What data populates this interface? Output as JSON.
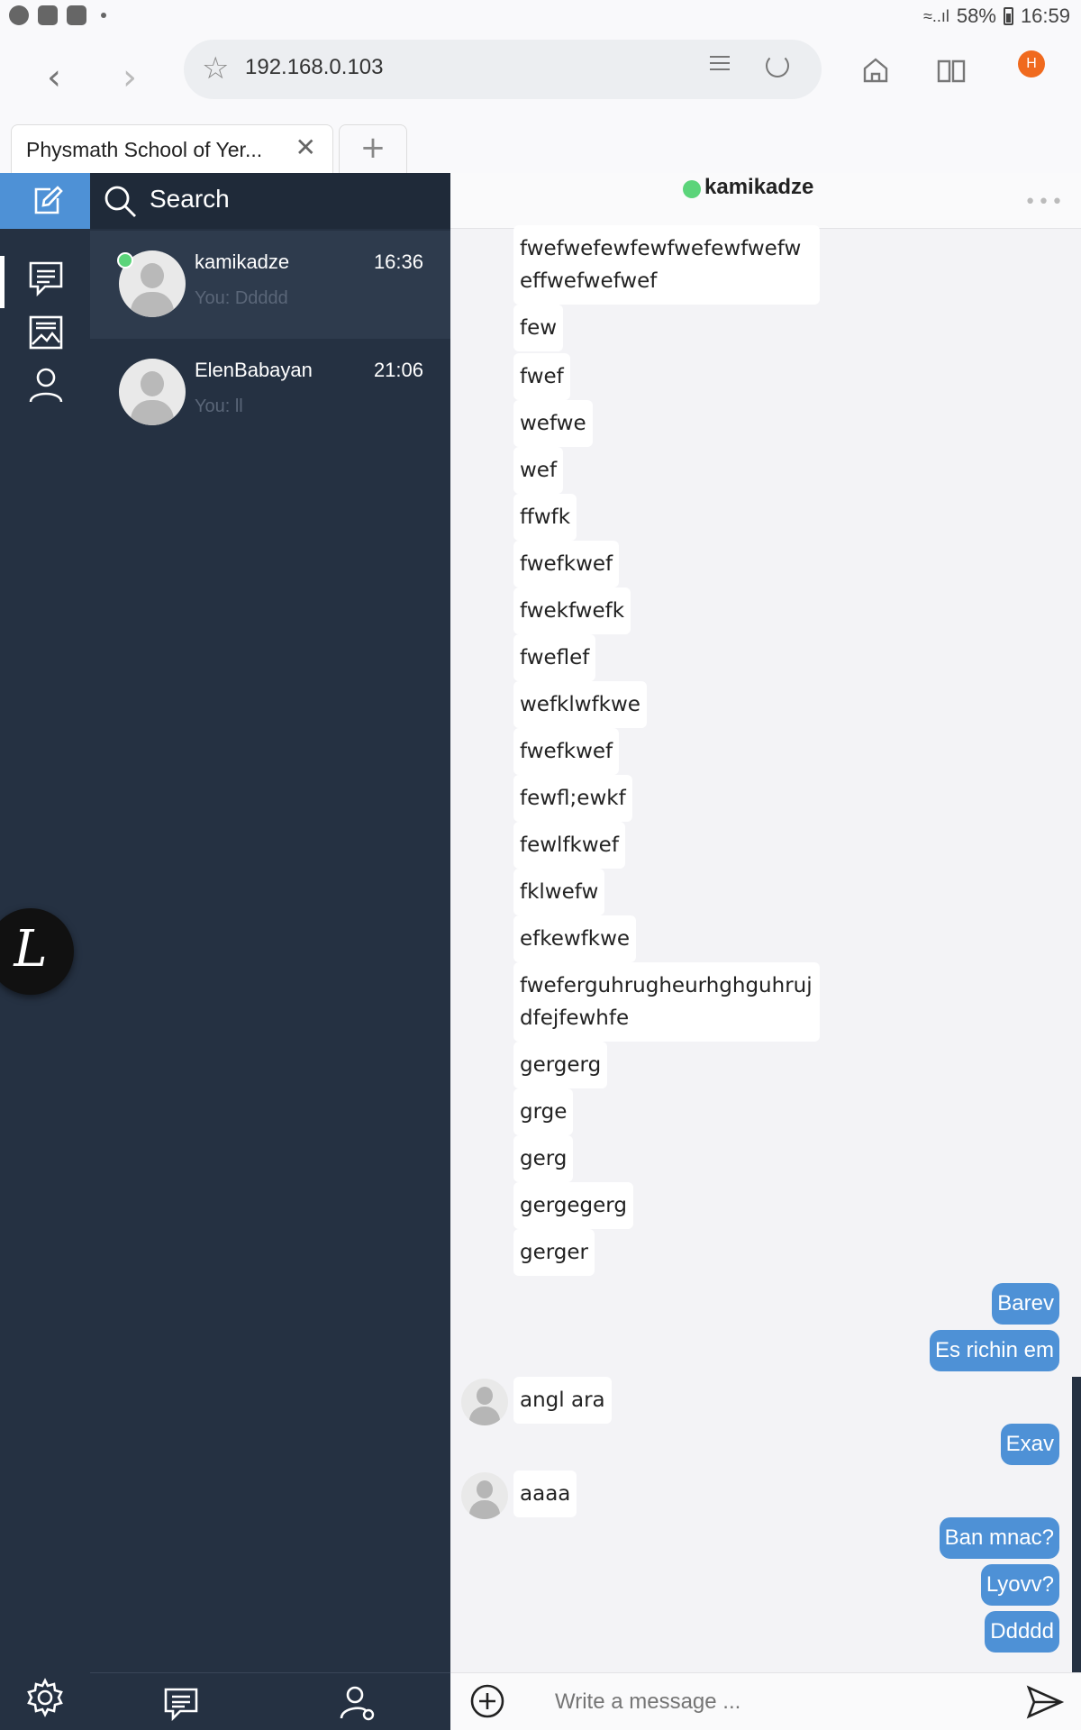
{
  "status_bar": {
    "battery": "58%",
    "time": "16:59"
  },
  "browser": {
    "url": "192.168.0.103",
    "tab_title": "Physmath School of Yer...",
    "profile_initial": "H"
  },
  "sidebar": {
    "search_label": "Search"
  },
  "conversations": [
    {
      "name": "kamikadze",
      "time": "16:36",
      "preview": "You: Ddddd"
    },
    {
      "name": "ElenBabayan",
      "time": "21:06",
      "preview": "You: ll"
    }
  ],
  "launcher_label": "L",
  "chat": {
    "title": "kamikadze",
    "more": "•••",
    "incoming": [
      "fwefwefewfewfwefewfwefweffwefwefwef",
      "few",
      "fwef",
      "wefwe",
      "wef",
      "ffwfk",
      "fwefkwef",
      "fwekfwefk",
      "fweflef",
      "wefklwfkwe",
      "fwefkwef",
      "fewfl;ewkf",
      "fewlfkwef",
      "fklwefw",
      "efkewfkwe",
      "fweferguhrugheurhghguhrujdfejfewhfe",
      "gergerg",
      "grge",
      "gerg",
      "gergegerg",
      "gerger"
    ],
    "thread": [
      {
        "text": "Barev",
        "mine": true
      },
      {
        "text": "Es richin em",
        "mine": true
      },
      {
        "text": "angl ara",
        "mine": false
      },
      {
        "text": "Exav",
        "mine": true
      },
      {
        "text": "aaaa",
        "mine": false
      },
      {
        "text": "Ban mnac?",
        "mine": true
      },
      {
        "text": "Lyovv?",
        "mine": true
      },
      {
        "text": "Ddddd",
        "mine": true
      }
    ],
    "input_placeholder": "Write a message ..."
  },
  "colors": {
    "accent": "#4e91d6",
    "sidebar": "#253142",
    "online": "#5bd47a"
  }
}
